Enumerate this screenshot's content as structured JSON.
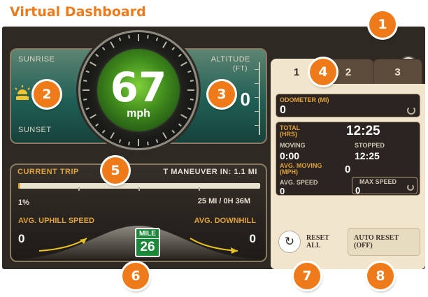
{
  "page_title": "Virtual Dashboard",
  "colors": {
    "accent": "#ef7a1a",
    "panel_dark": "#2f2924",
    "gauge_green": "#3f8a1c",
    "trip_label": "#e0a23a",
    "sign_green": "#1a8a3a"
  },
  "back_button": {
    "icon": "back-arrow-icon",
    "glyph": "↰"
  },
  "sun_panel": {
    "sunrise_label": "SUNRISE",
    "sunset_label": "SUNSET",
    "sun_icon": "sun-icon",
    "altitude_label": "ALTITUDE",
    "altitude_unit": "(FT)",
    "altitude_value": "0"
  },
  "speedometer": {
    "value": "67",
    "unit": "mph"
  },
  "trip": {
    "title": "CURRENT TRIP",
    "maneuver": "T MANEUVER IN: 1.1 MI",
    "progress_percent_label": "1%",
    "progress_fraction": 0.01,
    "distance_time": "25 MI / 0H 36M",
    "uphill_label": "AVG. UPHILL SPEED",
    "uphill_value": "0",
    "downhill_label": "AVG. DOWNHILL",
    "downhill_value": "0",
    "mile_sign_label": "MILE",
    "mile_sign_value": "26"
  },
  "tabs": [
    {
      "label": "1"
    },
    {
      "label": "2"
    },
    {
      "label": "3"
    }
  ],
  "odometer": {
    "label": "ODOMETER (MI)",
    "value": "0"
  },
  "timer": {
    "total_label_1": "TOTAL",
    "total_label_2": "(HRS)",
    "total_value": "12:25",
    "moving_label": "MOVING",
    "moving_value": "0:00",
    "stopped_label": "STOPPED",
    "stopped_value": "12:25",
    "avg_moving_label_1": "AVG. MOVING",
    "avg_moving_label_2": "(MPH)",
    "avg_moving_value": "0",
    "avg_speed_label": "AVG. SPEED",
    "avg_speed_value": "0",
    "max_speed_label": "MAX SPEED",
    "max_speed_value": "0"
  },
  "reset_all": {
    "icon_glyph": "↻",
    "line1": "RESET",
    "line2": "ALL"
  },
  "auto_reset": {
    "line1": "AUTO RESET",
    "line2": "(OFF)"
  },
  "markers": [
    "1",
    "2",
    "3",
    "4",
    "5",
    "6",
    "7",
    "8"
  ]
}
